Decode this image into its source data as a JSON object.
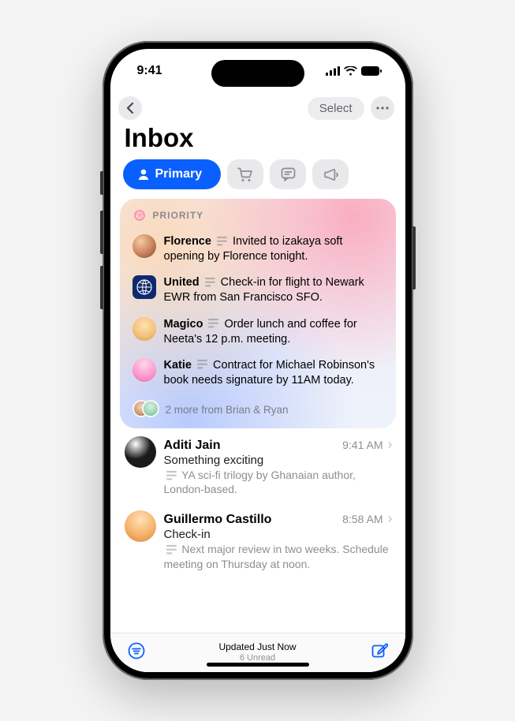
{
  "status": {
    "time": "9:41"
  },
  "nav": {
    "select_label": "Select"
  },
  "title": "Inbox",
  "categories": {
    "primary_label": "Primary"
  },
  "priority": {
    "header": "PRIORITY",
    "items": [
      {
        "sender": "Florence",
        "summary": "Invited to izakaya soft opening by Florence tonight."
      },
      {
        "sender": "United",
        "summary": "Check-in for flight to Newark EWR from San Francisco SFO."
      },
      {
        "sender": "Magico",
        "summary": "Order lunch and coffee for Neeta's 12 p.m. meeting."
      },
      {
        "sender": "Katie",
        "summary": "Contract for Michael Robinson's book needs signature by 11AM today."
      }
    ],
    "more_text": "2 more from Brian & Ryan"
  },
  "messages": [
    {
      "sender": "Aditi Jain",
      "time": "9:41 AM",
      "subject": "Something exciting",
      "preview": "YA sci-fi trilogy by Ghanaian author, London-based."
    },
    {
      "sender": "Guillermo Castillo",
      "time": "8:58 AM",
      "subject": "Check-in",
      "preview": "Next major review in two weeks. Schedule meeting on Thursday at noon."
    }
  ],
  "toolbar": {
    "status": "Updated Just Now",
    "unread": "6 Unread"
  }
}
